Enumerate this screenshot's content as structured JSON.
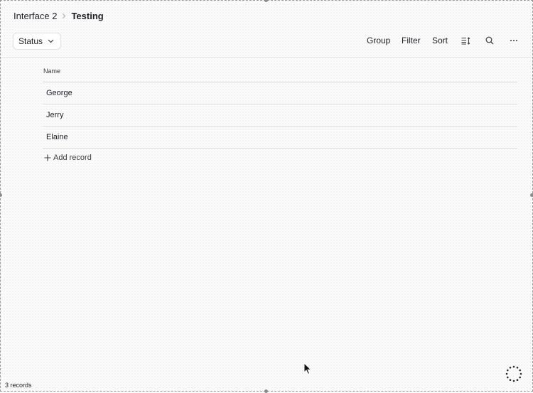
{
  "breadcrumb": {
    "parent": "Interface 2",
    "current": "Testing"
  },
  "toolbar": {
    "status_label": "Status",
    "group_label": "Group",
    "filter_label": "Filter",
    "sort_label": "Sort",
    "row_height_icon": "row-height-icon",
    "search_icon": "search-icon",
    "more_icon": "more-options-icon"
  },
  "table": {
    "column_header": "Name",
    "rows": [
      "George",
      "Jerry",
      "Elaine"
    ],
    "add_record_label": "Add record"
  },
  "footer": {
    "record_count": "3 records"
  },
  "colors": {
    "text": "#1d1f25",
    "border": "#dcdcdc",
    "background": "#fbfbfb"
  }
}
